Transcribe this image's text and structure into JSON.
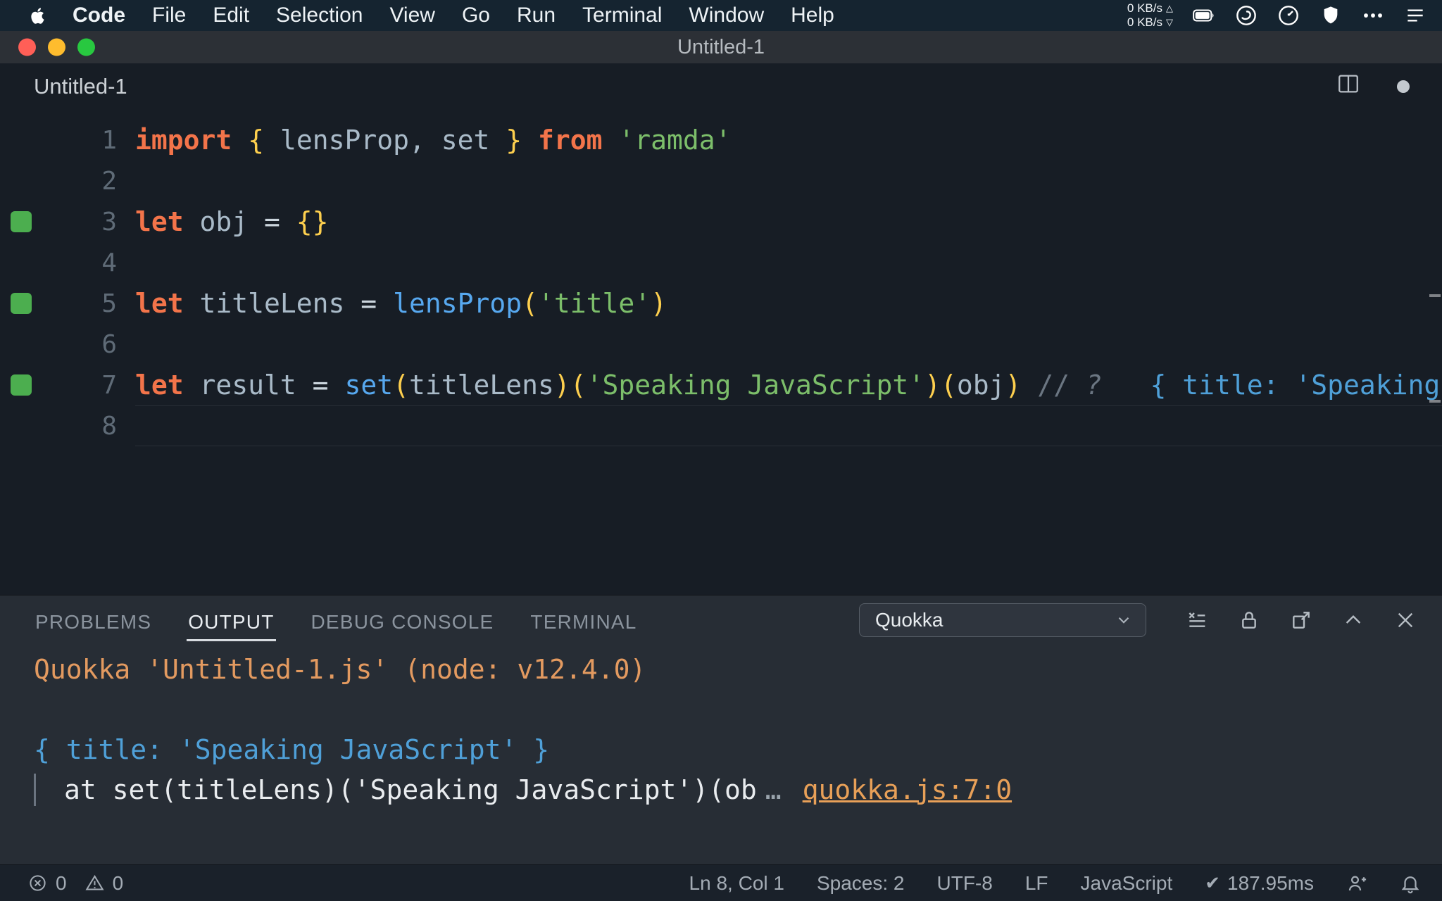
{
  "menu_bar": {
    "items": [
      "Code",
      "File",
      "Edit",
      "Selection",
      "View",
      "Go",
      "Run",
      "Terminal",
      "Window",
      "Help"
    ],
    "network": {
      "up": "0 KB/s",
      "down": "0 KB/s"
    }
  },
  "title_bar": {
    "title": "Untitled-1"
  },
  "editor": {
    "title": "Untitled-1",
    "lines": [
      {
        "num": "1",
        "coverage": false,
        "current": false,
        "segments": [
          [
            "keyword",
            "import"
          ],
          [
            "plain",
            " "
          ],
          [
            "brace",
            "{"
          ],
          [
            "ident",
            " lensProp, set "
          ],
          [
            "brace",
            "}"
          ],
          [
            "plain",
            " "
          ],
          [
            "keyword",
            "from"
          ],
          [
            "plain",
            " "
          ],
          [
            "string",
            "'ramda'"
          ]
        ]
      },
      {
        "num": "2",
        "coverage": false,
        "current": false,
        "segments": []
      },
      {
        "num": "3",
        "coverage": true,
        "current": false,
        "segments": [
          [
            "keyword",
            "let"
          ],
          [
            "ident",
            " obj"
          ],
          [
            "op",
            " = "
          ],
          [
            "brace",
            "{}"
          ]
        ]
      },
      {
        "num": "4",
        "coverage": false,
        "current": false,
        "segments": []
      },
      {
        "num": "5",
        "coverage": true,
        "current": false,
        "segments": [
          [
            "keyword",
            "let"
          ],
          [
            "ident",
            " titleLens"
          ],
          [
            "op",
            " = "
          ],
          [
            "func",
            "lensProp"
          ],
          [
            "brace",
            "("
          ],
          [
            "string",
            "'title'"
          ],
          [
            "brace",
            ")"
          ]
        ]
      },
      {
        "num": "6",
        "coverage": false,
        "current": false,
        "segments": []
      },
      {
        "num": "7",
        "coverage": true,
        "current": false,
        "segments": [
          [
            "keyword",
            "let"
          ],
          [
            "ident",
            " result"
          ],
          [
            "op",
            " = "
          ],
          [
            "func",
            "set"
          ],
          [
            "brace",
            "("
          ],
          [
            "ident",
            "titleLens"
          ],
          [
            "brace",
            ")("
          ],
          [
            "string",
            "'Speaking JavaScript'"
          ],
          [
            "brace",
            ")("
          ],
          [
            "ident",
            "obj"
          ],
          [
            "brace",
            ")"
          ],
          [
            "plain",
            " "
          ],
          [
            "comment",
            "// "
          ],
          [
            "comment-italic",
            "?"
          ],
          [
            "plain",
            "   "
          ],
          [
            "inline",
            "{ title: 'Speaking Ja"
          ]
        ]
      },
      {
        "num": "8",
        "coverage": false,
        "current": true,
        "segments": []
      }
    ]
  },
  "panel": {
    "tabs": [
      {
        "label": "PROBLEMS",
        "active": false
      },
      {
        "label": "OUTPUT",
        "active": true
      },
      {
        "label": "DEBUG CONSOLE",
        "active": false
      },
      {
        "label": "TERMINAL",
        "active": false
      }
    ],
    "channel_selector": "Quokka",
    "output_lines": {
      "header": "Quokka 'Untitled-1.js' (node: v12.4.0)",
      "result": "{ title: 'Speaking JavaScript' }",
      "stack": "at set(titleLens)('Speaking JavaScript')(ob",
      "stack_ellipsis": "…",
      "stack_link": "quokka.js:7:0"
    }
  },
  "status_bar": {
    "errors": "0",
    "warnings": "0",
    "cursor": "Ln 8, Col 1",
    "indent": "Spaces: 2",
    "encoding": "UTF-8",
    "eol": "LF",
    "language": "JavaScript",
    "quokka_time": "187.95ms"
  },
  "colors": {
    "keyword": "#f3744a",
    "brace": "#fdcf4e",
    "string": "#7cbe6a",
    "function_call": "#57a8ef",
    "identifier": "#a9bac8",
    "comment": "#6b7682",
    "inline_value": "#4fa0d8",
    "coverage_green": "#4cae4f",
    "output_header": "#e39a60",
    "output_result": "#4fa0d8",
    "link": "#e8a058",
    "editor_bg": "#171d25",
    "panel_bg": "#272d35",
    "menubar_bg": "#152430",
    "titlebar_bg": "#2c3036",
    "statusbar_bg": "#1a212a"
  }
}
